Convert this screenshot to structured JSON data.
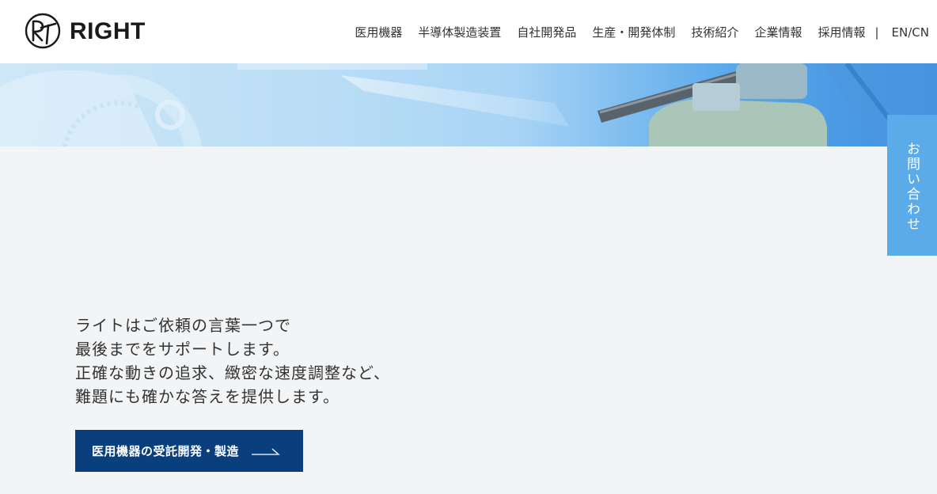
{
  "header": {
    "brand": "RIGHT",
    "nav": [
      {
        "label": "医用機器"
      },
      {
        "label": "半導体製造装置"
      },
      {
        "label": "自社開発品"
      },
      {
        "label": "生産・開発体制"
      },
      {
        "label": "技術紹介"
      },
      {
        "label": "企業情報"
      },
      {
        "label": "採用情報"
      }
    ],
    "separator": "|",
    "lang_label": "EN/CN"
  },
  "side_tab": {
    "label": "お問い合わせ"
  },
  "hero": {
    "tagline": [
      "ライトはご依頼の言葉一つで",
      "最後までをサポートします。",
      "正確な動きの追求、緻密な速度調整など、",
      "難題にも確かな答えを提供します。"
    ]
  },
  "cta": {
    "label": "医用機器の受託開発・製造",
    "arrow_icon": "long-arrow-right-icon"
  },
  "colors": {
    "accent_navy": "#0a3f7e",
    "side_tab_blue": "#5aabe8",
    "page_bg": "#f2f4f6"
  }
}
